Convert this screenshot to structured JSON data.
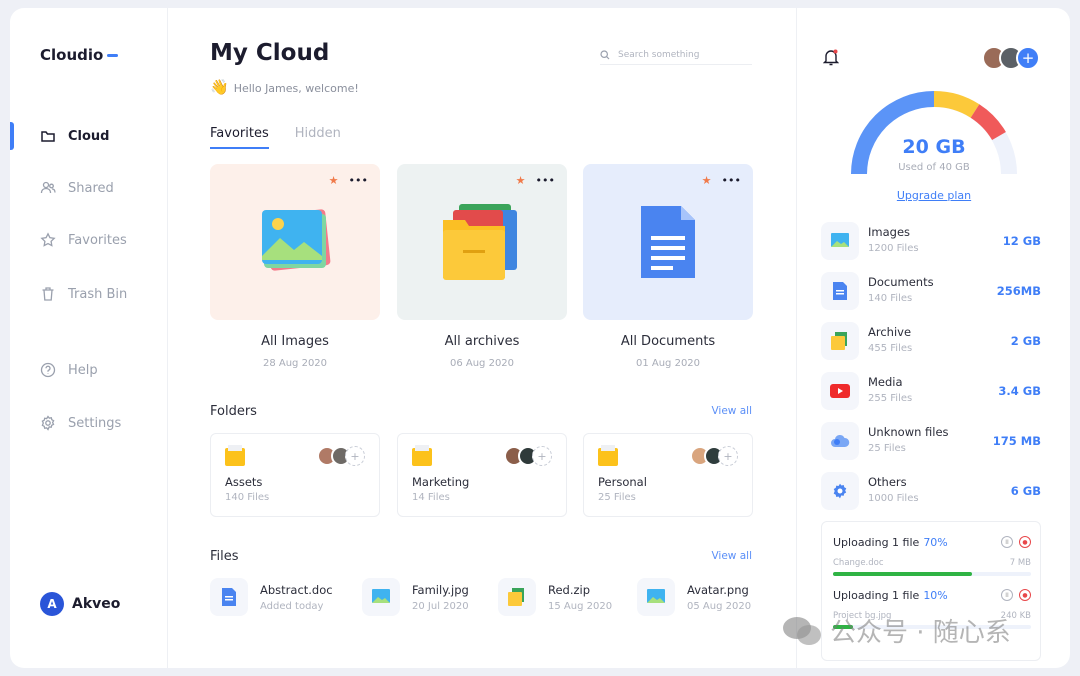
{
  "app": {
    "name": "Cloudio",
    "brand": "Akveo",
    "brand_initial": "A"
  },
  "sidebar": {
    "items": [
      {
        "label": "Cloud",
        "icon": "folder-icon",
        "active": true
      },
      {
        "label": "Shared",
        "icon": "users-icon"
      },
      {
        "label": "Favorites",
        "icon": "star-icon"
      },
      {
        "label": "Trash Bin",
        "icon": "trash-icon"
      },
      {
        "label": "Help",
        "icon": "help-icon"
      },
      {
        "label": "Settings",
        "icon": "gear-icon"
      }
    ]
  },
  "header": {
    "title": "My Cloud",
    "greeting_emoji": "👋",
    "greeting": "Hello James, welcome!",
    "search_placeholder": "Search something"
  },
  "tabs": [
    {
      "label": "Favorites",
      "active": true
    },
    {
      "label": "Hidden"
    }
  ],
  "favorites": [
    {
      "label": "All Images",
      "date": "28 Aug 2020",
      "bg": "#fdf0ea"
    },
    {
      "label": "All archives",
      "date": "06 Aug 2020",
      "bg": "#edf2f2"
    },
    {
      "label": "All Documents",
      "date": "01 Aug 2020",
      "bg": "#e6edfc"
    }
  ],
  "more_label": "•••",
  "star": "★",
  "folders": {
    "title": "Folders",
    "view_all": "View all",
    "items": [
      {
        "name": "Assets",
        "count": "140 Files"
      },
      {
        "name": "Marketing",
        "count": "14 Files"
      },
      {
        "name": "Personal",
        "count": "25 Files"
      }
    ],
    "add": "+"
  },
  "files": {
    "title": "Files",
    "view_all": "View all",
    "items": [
      {
        "name": "Abstract.doc",
        "date": "Added today",
        "type": "doc"
      },
      {
        "name": "Family.jpg",
        "date": "20 Jul 2020",
        "type": "image"
      },
      {
        "name": "Red.zip",
        "date": "15 Aug 2020",
        "type": "archive"
      },
      {
        "name": "Avatar.png",
        "date": "05 Aug 2020",
        "type": "image"
      }
    ]
  },
  "storage": {
    "used": "20 GB",
    "caption": "Used of 40 GB",
    "upgrade": "Upgrade plan",
    "colors": {
      "blue": "#5b94f7",
      "yellow": "#fcc93a",
      "red": "#f05a5a",
      "track": "#eef2fb"
    }
  },
  "categories": [
    {
      "name": "Images",
      "count": "1200 Files",
      "size": "12 GB"
    },
    {
      "name": "Documents",
      "count": "140 Files",
      "size": "256MB"
    },
    {
      "name": "Archive",
      "count": "455 Files",
      "size": "2 GB"
    },
    {
      "name": "Media",
      "count": "255 Files",
      "size": "3.4 GB"
    },
    {
      "name": "Unknown files",
      "count": "25 Files",
      "size": "175 MB"
    },
    {
      "name": "Others",
      "count": "1000 Files",
      "size": "6 GB"
    }
  ],
  "uploads": [
    {
      "title": "Uploading 1 file",
      "percent": "70%",
      "progress": 70,
      "file": "Change.doc",
      "size": "7 MB"
    },
    {
      "title": "Uploading 1 file",
      "percent": "10%",
      "progress": 10,
      "file": "Project bg.jpg",
      "size": "240 KB"
    }
  ],
  "watermark": "公众号 · 随心系"
}
